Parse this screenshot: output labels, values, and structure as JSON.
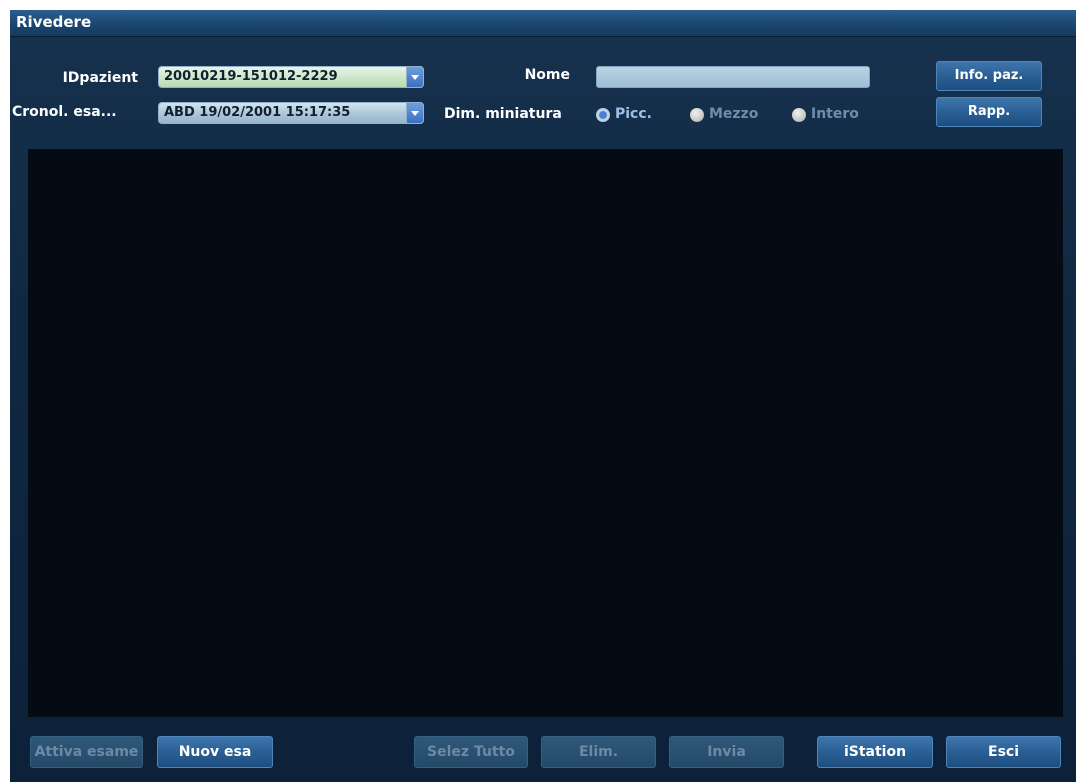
{
  "window": {
    "title": "Rivedere"
  },
  "patient": {
    "id_label": "IDpazient",
    "id_value": "20010219-151012-2229",
    "history_label": "Cronol. esa...",
    "history_value": "ABD 19/02/2001 15:17:35",
    "name_label": "Nome",
    "name_value": ""
  },
  "thumbnail": {
    "label": "Dim. miniatura",
    "options": [
      {
        "label": "Picc.",
        "selected": true
      },
      {
        "label": "Mezzo",
        "selected": false
      },
      {
        "label": "Intero",
        "selected": false
      }
    ]
  },
  "buttons": {
    "info": "Info. paz.",
    "report": "Rapp.",
    "activate_exam": "Attiva esame",
    "new_exam": "Nuov esa",
    "select_all": "Selez Tutto",
    "delete": "Elim.",
    "send": "Invia",
    "istation": "iStation",
    "exit": "Esci"
  },
  "colors": {
    "accent": "#2a5f94",
    "background": "#102842",
    "thumbnail_area": "#050b12"
  }
}
